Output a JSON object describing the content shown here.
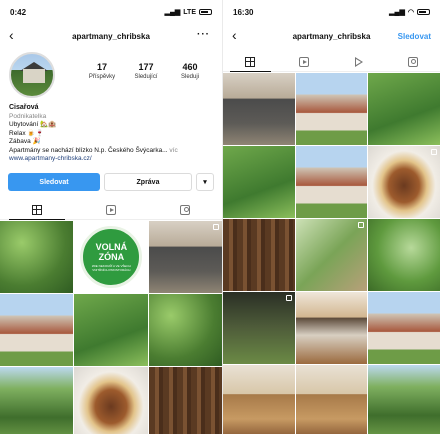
{
  "left": {
    "status": {
      "time": "0:42",
      "network": "LTE"
    },
    "nav": {
      "username": "apartmany_chribska",
      "more": "···"
    },
    "stats": [
      {
        "value": "17",
        "label": "Příspěvky"
      },
      {
        "value": "177",
        "label": "Sledující"
      },
      {
        "value": "460",
        "label": "Sleduji"
      }
    ],
    "bio": {
      "name": "Cisařová",
      "category": "Podnikatelka",
      "lines": [
        "Ubytování 🏡🏨",
        "Relax 🍺🍷",
        "Zábava 🎉"
      ],
      "description": "Apartmány se nachází blízko N.p. Českého Švýcarka...",
      "more": "víc",
      "link": "www.apartmany-chribska.cz/"
    },
    "buttons": {
      "follow": "Sledovat",
      "message": "Zpráva",
      "dropdown": "▾"
    },
    "zona": {
      "title_line1": "VOLNÁ",
      "title_line2": "ZÓNA",
      "small": "ZDE NEKOUŘÍ A VE VŠECH VNITŘNÍCH PROSTORÁCH"
    },
    "tiles": [
      "t-garden",
      "zona",
      "t-terrace",
      "t-house",
      "t-green",
      "t-garden",
      "t-forest",
      "t-cake",
      "t-wood"
    ]
  },
  "right": {
    "status": {
      "time": "16:30"
    },
    "nav": {
      "username": "apartmany_chribska",
      "follow": "Sledovat"
    },
    "tiles": [
      "t-terrace",
      "t-house",
      "t-green",
      "t-green",
      "t-house",
      "t-cake",
      "t-wood",
      "t-bike",
      "t-herb",
      "t-night",
      "t-kitchen",
      "t-house",
      "t-interior",
      "t-interior",
      "t-forest"
    ]
  }
}
